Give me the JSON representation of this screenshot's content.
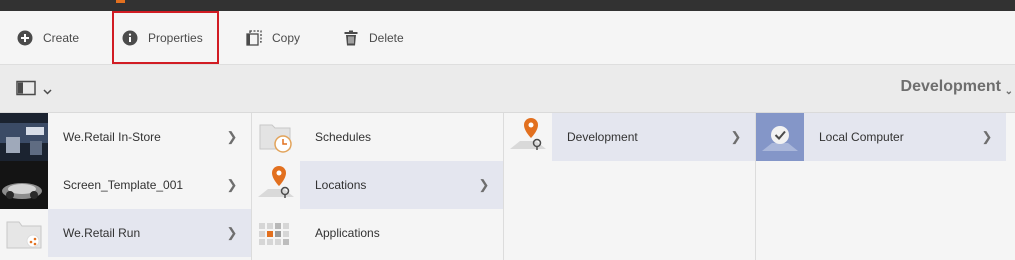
{
  "toolbar": {
    "create_label": "Create",
    "properties_label": "Properties",
    "copy_label": "Copy",
    "delete_label": "Delete"
  },
  "context": {
    "title": "Development"
  },
  "columns": [
    {
      "items": [
        {
          "label": "We.Retail In-Store"
        },
        {
          "label": "Screen_Template_001"
        },
        {
          "label": "We.Retail Run"
        }
      ]
    },
    {
      "items": [
        {
          "label": "Schedules"
        },
        {
          "label": "Locations"
        },
        {
          "label": "Applications"
        }
      ]
    },
    {
      "items": [
        {
          "label": "Development"
        }
      ]
    },
    {
      "items": [
        {
          "label": "Local Computer"
        }
      ]
    }
  ],
  "colors": {
    "selected_bg": "#e4e6ef",
    "highlight_border": "#d11c23",
    "accent_orange": "#e2701f"
  }
}
